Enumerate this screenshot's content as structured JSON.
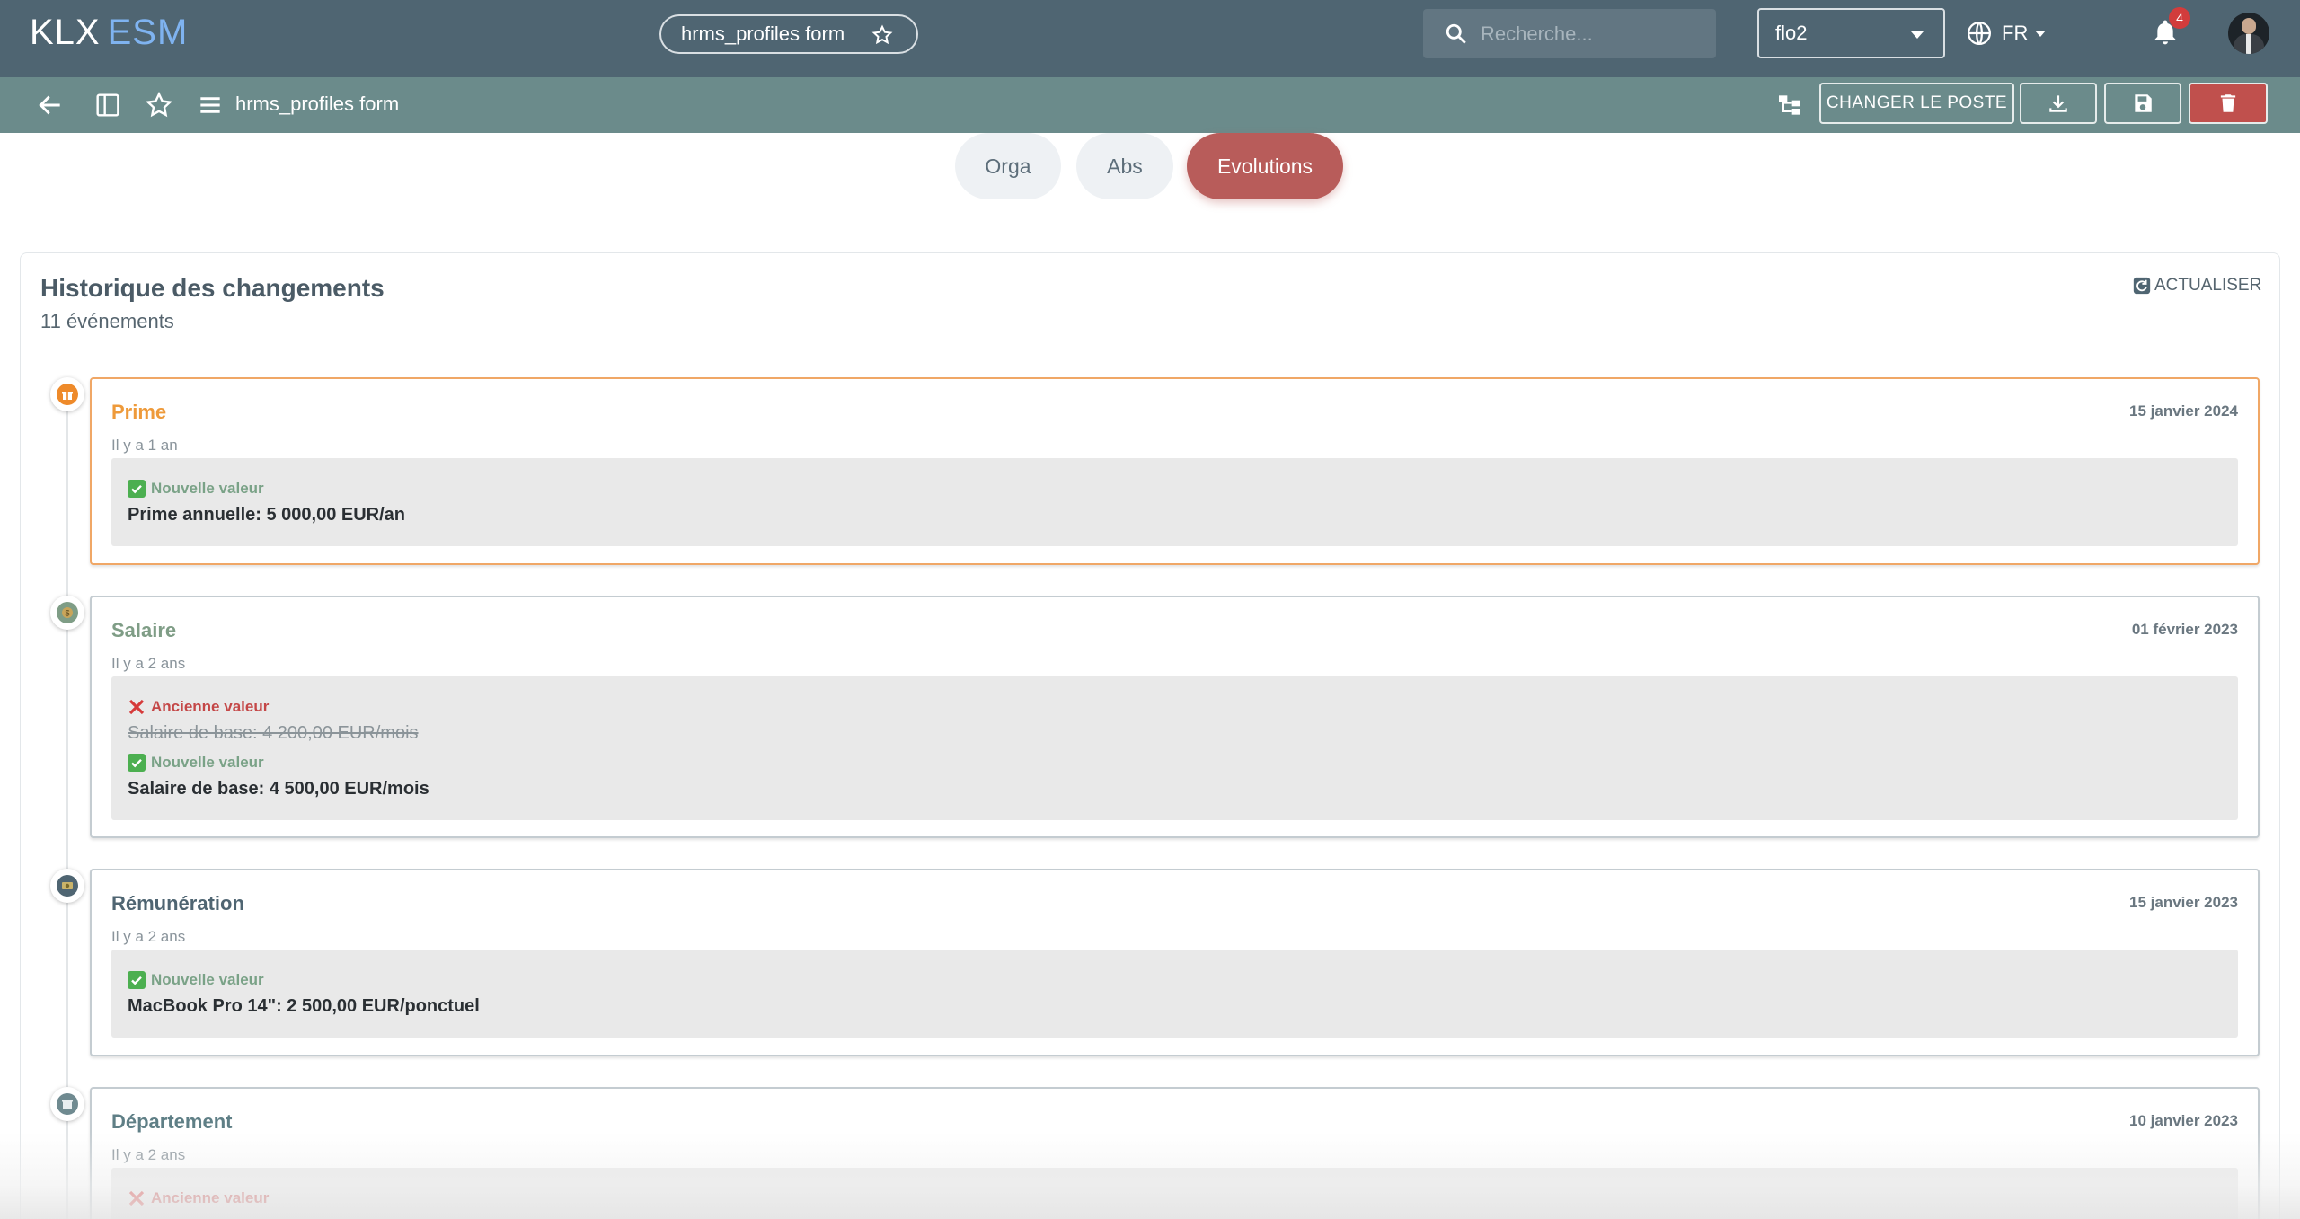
{
  "app": {
    "logo_primary": "KLX",
    "logo_secondary": "ESM"
  },
  "header": {
    "form_pill_label": "hrms_profiles form",
    "search_placeholder": "Recherche...",
    "user_value": "flo2",
    "language": "FR",
    "notification_count": "4"
  },
  "toolbar": {
    "title": "hrms_profiles form",
    "change_post_label": "CHANGER LE POSTE"
  },
  "tabs": [
    {
      "label": "Orga",
      "active": false
    },
    {
      "label": "Abs",
      "active": false
    },
    {
      "label": "Evolutions",
      "active": true
    }
  ],
  "history": {
    "title": "Historique des changements",
    "count_label": "11 événements",
    "refresh_label": "ACTUALISER",
    "events": [
      {
        "title": "Prime",
        "title_color": "#ee9a3a",
        "icon": "gift-icon",
        "icon_color": "#ee8a2a",
        "date": "15 janvier 2024",
        "ago": "Il y a 1 an",
        "new_label": "Nouvelle valeur",
        "new_value": "Prime annuelle: 5 000,00 EUR/an"
      },
      {
        "title": "Salaire",
        "title_color": "#7f9d86",
        "icon": "coin-icon",
        "icon_color": "#7f9d86",
        "date": "01 février 2023",
        "ago": "Il y a 2 ans",
        "old_label": "Ancienne valeur",
        "old_value": "Salaire de base: 4 200,00 EUR/mois",
        "new_label": "Nouvelle valeur",
        "new_value": "Salaire de base: 4 500,00 EUR/mois"
      },
      {
        "title": "Rémunération",
        "title_color": "#4f6572",
        "icon": "money-icon",
        "icon_color": "#4f6572",
        "date": "15 janvier 2023",
        "ago": "Il y a 2 ans",
        "new_label": "Nouvelle valeur",
        "new_value": "MacBook Pro 14\": 2 500,00 EUR/ponctuel"
      },
      {
        "title": "Département",
        "title_color": "#5f7f86",
        "icon": "building-icon",
        "icon_color": "#6f8a90",
        "date": "10 janvier 2023",
        "ago": "Il y a 2 ans",
        "old_label": "Ancienne valeur"
      }
    ]
  },
  "colors": {
    "topbar": "#4f6572",
    "toolbar": "#6b8b8b",
    "active_tab": "#b85c5a",
    "danger": "#c0504d"
  }
}
